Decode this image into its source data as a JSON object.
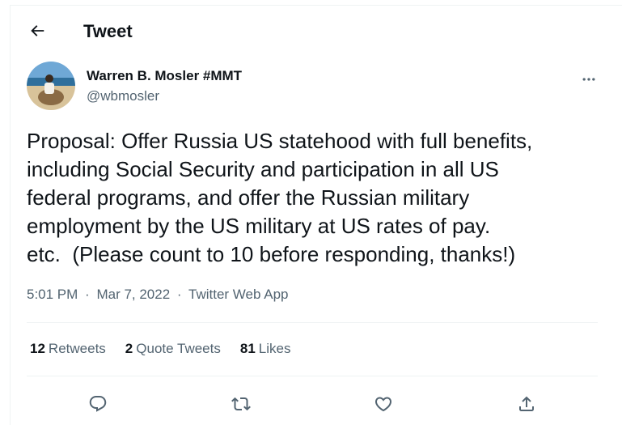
{
  "header": {
    "title": "Tweet"
  },
  "author": {
    "name": "Warren B. Mosler #MMT",
    "handle": "@wbmosler"
  },
  "tweet": {
    "text": "Proposal: Offer Russia US statehood with full benefits,\nincluding Social Security and participation in all US\nfederal programs, and offer the Russian military\nemployment by the US military at US rates of pay.\netc.  (Please count to 10 before responding, thanks!)",
    "time": "5:01 PM",
    "date": "Mar 7, 2022",
    "source": "Twitter Web App",
    "separator": "·"
  },
  "stats": {
    "retweets_count": "12",
    "retweets_label": "Retweets",
    "quotes_count": "2",
    "quotes_label": "Quote Tweets",
    "likes_count": "81",
    "likes_label": "Likes"
  },
  "icons": {
    "back": "arrow-left-icon",
    "more": "more-horizontal-icon",
    "reply": "reply-icon",
    "retweet": "retweet-icon",
    "like": "heart-icon",
    "share": "share-icon"
  },
  "colors": {
    "text": "#0f1419",
    "secondary": "#536471",
    "divider": "#eff3f4"
  }
}
